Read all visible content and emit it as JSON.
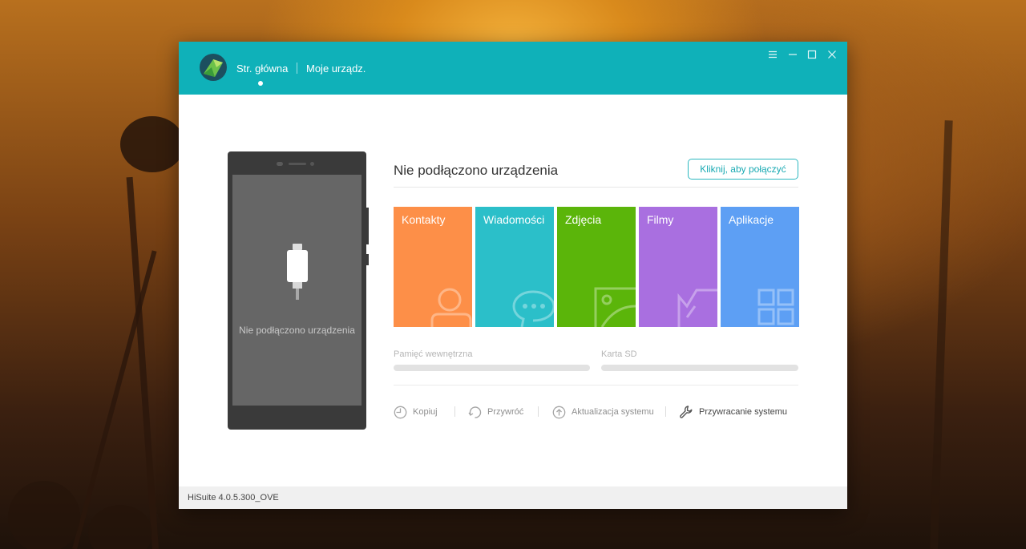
{
  "window": {
    "nav": {
      "home_label": "Str. główna",
      "devices_label": "Moje urządz."
    },
    "controls": {
      "menu_icon": "hamburger-icon",
      "minimize_icon": "minimize-icon",
      "maximize_icon": "maximize-icon",
      "close_icon": "close-icon"
    },
    "accent_color": "#0fb1b9"
  },
  "phone": {
    "screen_message": "Nie podłączono urządzenia"
  },
  "device": {
    "status_title": "Nie podłączono urządzenia",
    "connect_button": "Kliknij, aby połączyć"
  },
  "tiles": [
    {
      "label": "Kontakty",
      "color": "#fd8f48",
      "icon": "contact-icon"
    },
    {
      "label": "Wiadomości",
      "color": "#2bbfc9",
      "icon": "chat-icon"
    },
    {
      "label": "Zdjęcia",
      "color": "#5bb50a",
      "icon": "photo-icon"
    },
    {
      "label": "Filmy",
      "color": "#a96fe0",
      "icon": "film-icon"
    },
    {
      "label": "Aplikacje",
      "color": "#5d9ff4",
      "icon": "apps-icon"
    }
  ],
  "storage": {
    "internal_label": "Pamięć wewnętrzna",
    "sd_label": "Karta SD"
  },
  "actions": {
    "backup": "Kopiuj",
    "restore": "Przywróć",
    "update": "Aktualizacja systemu",
    "recovery": "Przywracanie systemu"
  },
  "footer": {
    "version": "HiSuite 4.0.5.300_OVE"
  }
}
